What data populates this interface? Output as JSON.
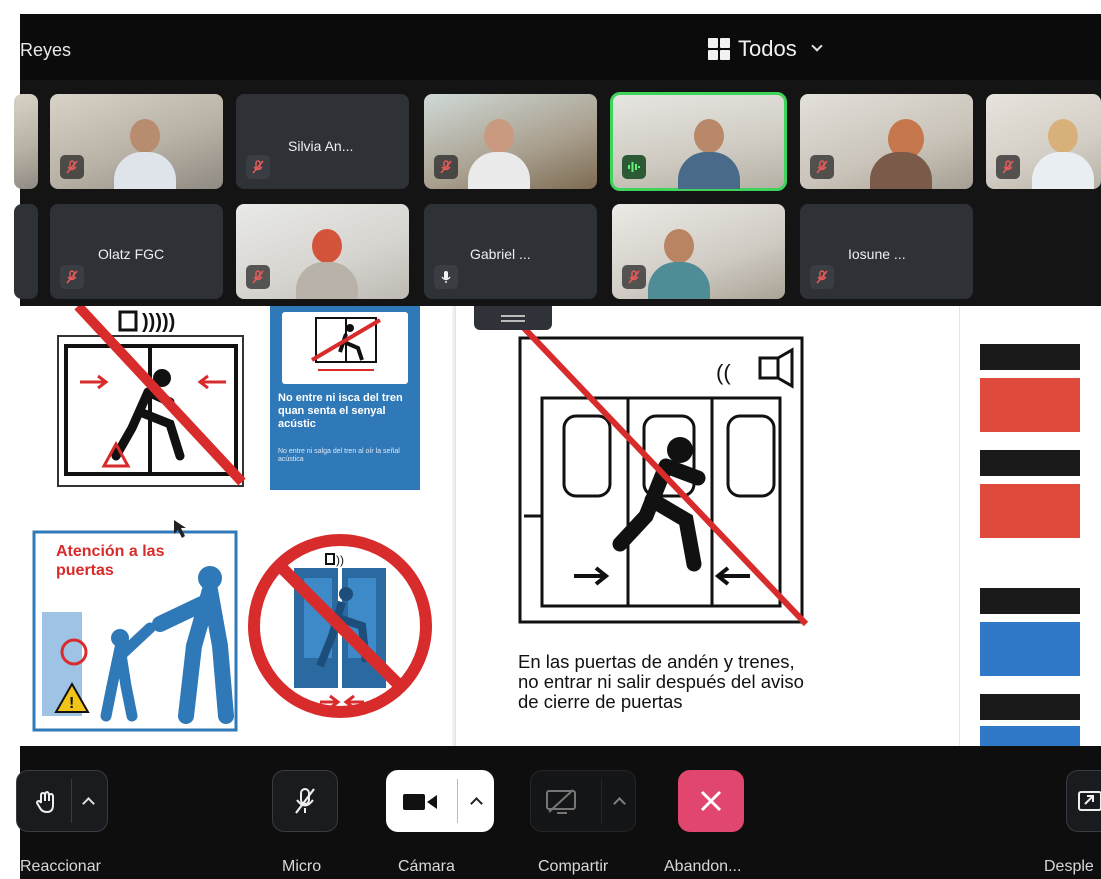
{
  "meeting": {
    "host_name": "Reyes",
    "view_label": "Todos"
  },
  "participants": [
    {
      "name": "Silvia An...",
      "mic": "muted"
    },
    {
      "name": "Olatz FGC",
      "mic": "muted"
    },
    {
      "name": "Gabriel ...",
      "mic": "on"
    },
    {
      "name": "Iosune ...",
      "mic": "muted"
    }
  ],
  "slide": {
    "caption": "En las puertas de andén y trenes, no entrar ni salir después del aviso de cierre de puertas",
    "sign_text_main": "No entre ni isca del tren quan senta el senyal acústic",
    "sign_text_small": "No entre ni salga del tren al oír la señal acústica",
    "sign_title": "Atención a las puertas"
  },
  "toolbar": {
    "reactions": "Reaccionar",
    "mic": "Micro",
    "camera": "Cámara",
    "share": "Compartir",
    "leave": "Abandon...",
    "more": "Desple"
  },
  "colors": {
    "speaking_outline": "#3ed35b",
    "leave_button": "#e0466e",
    "sign_red": "#d82b2b",
    "sign_blue": "#2f79b8"
  },
  "icons": [
    "grid-icon",
    "chevron-down-icon",
    "mic-muted-icon",
    "mic-icon",
    "audio-wave-icon",
    "hand-icon",
    "camera-icon",
    "share-screen-icon",
    "close-icon",
    "expand-icon"
  ]
}
